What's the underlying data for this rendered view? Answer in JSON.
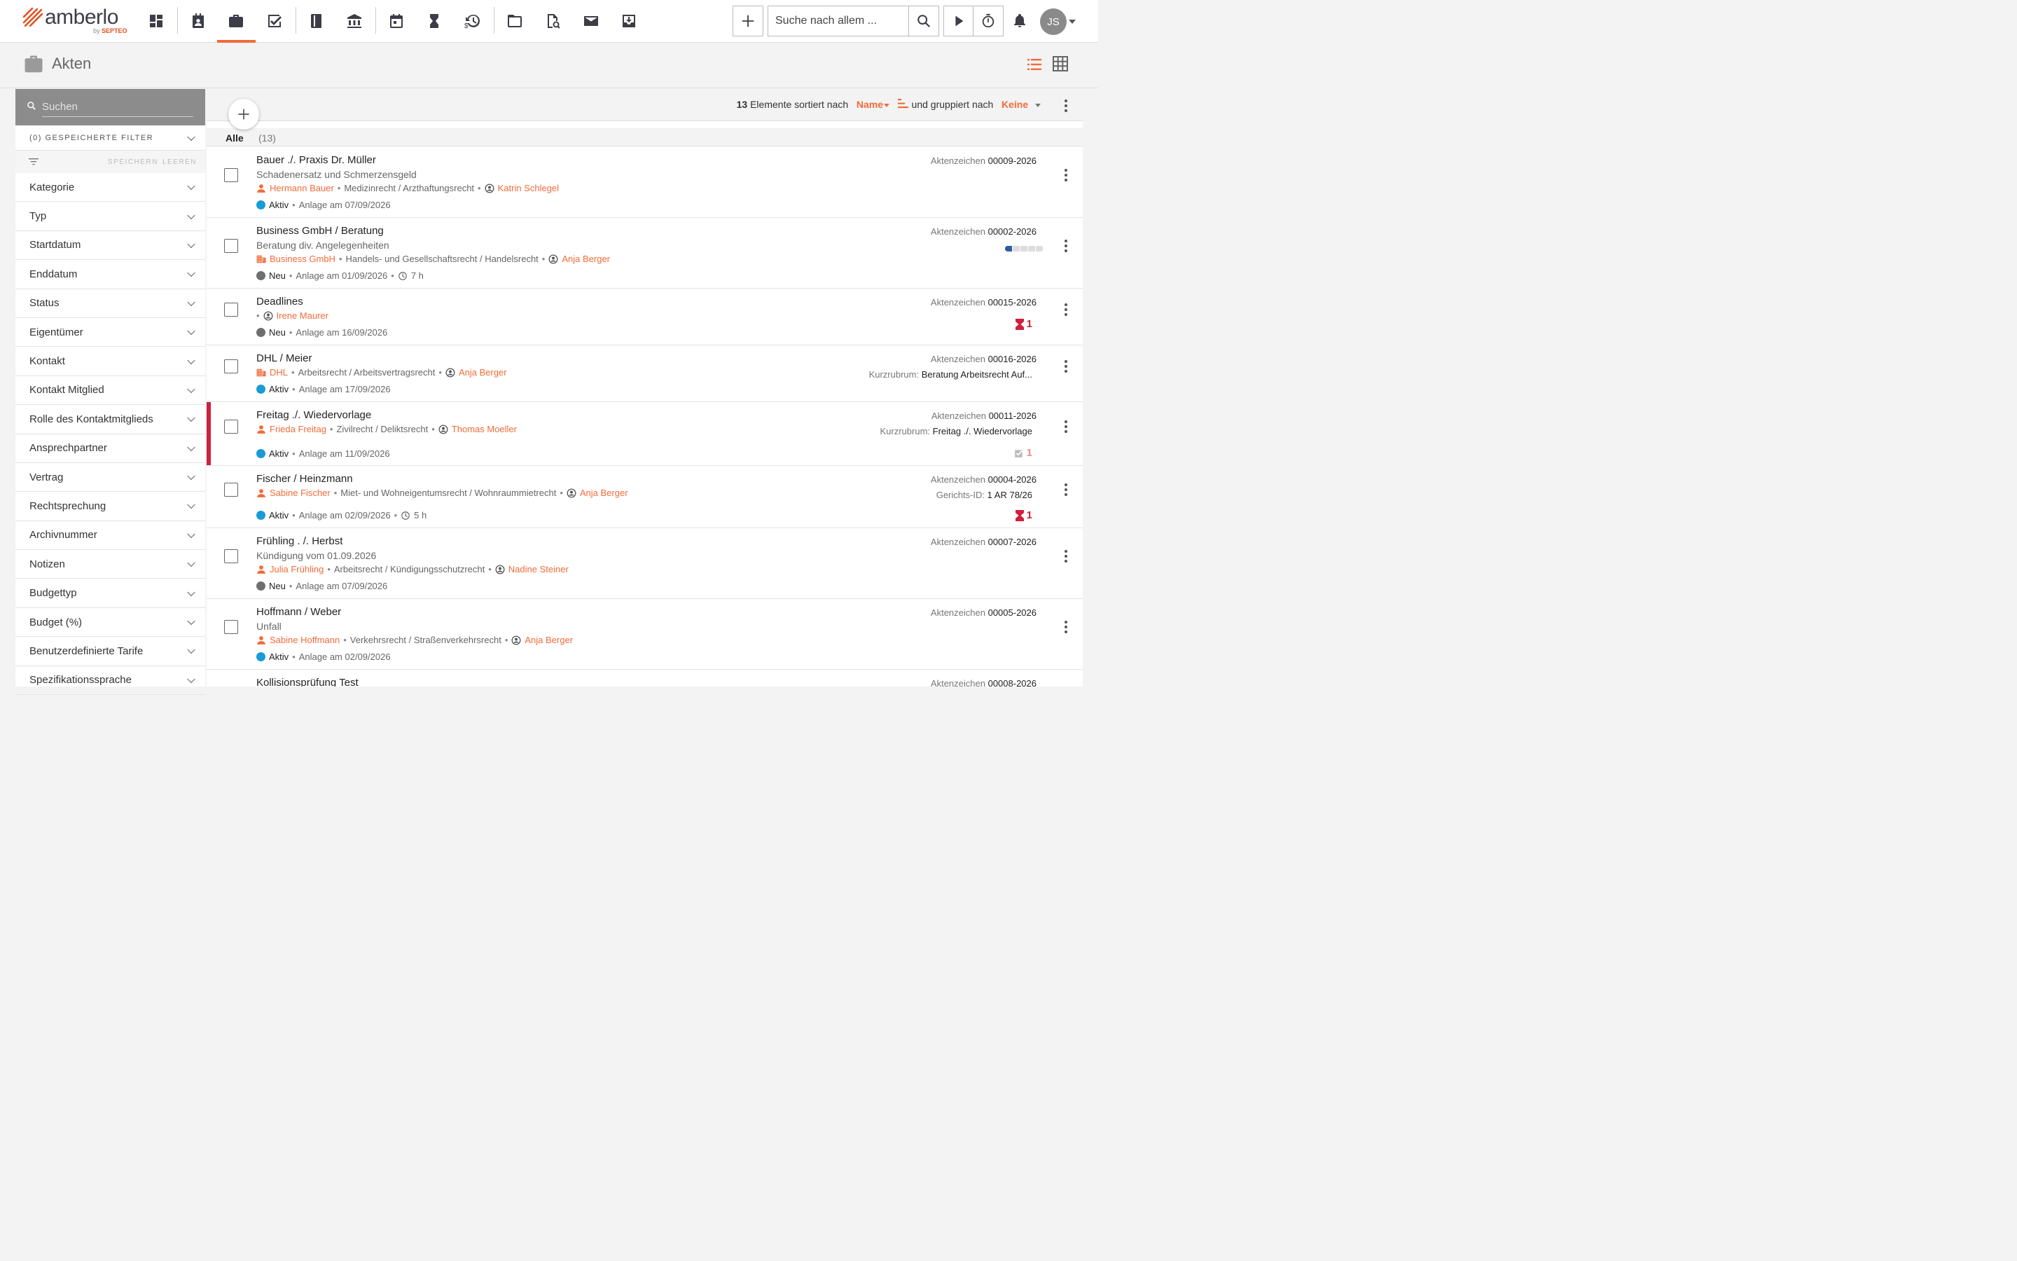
{
  "app": {
    "logo_text": "amberlo",
    "logo_by": "by",
    "logo_brand": "SEPTEO",
    "avatar_initials": "JS"
  },
  "topbar": {
    "search_placeholder": "Suche nach allem ..."
  },
  "page": {
    "title": "Akten"
  },
  "sidebar": {
    "search_placeholder": "Suchen",
    "saved_filters": "(0) GESPEICHERTE FILTER",
    "save_label": "SPEICHERN",
    "clear_label": "LEEREN",
    "filters": [
      "Kategorie",
      "Typ",
      "Startdatum",
      "Enddatum",
      "Status",
      "Eigentümer",
      "Kontakt",
      "Kontakt Mitglied",
      "Rolle des Kontaktmitglieds",
      "Ansprechpartner",
      "Vertrag",
      "Rechtsprechung",
      "Archivnummer",
      "Notizen",
      "Budgettyp",
      "Budget (%)",
      "Benutzerdefinierte Tarife",
      "Spezifikationssprache"
    ]
  },
  "list": {
    "count": "13",
    "sorted_text": "Elemente sortiert nach",
    "sort_value": "Name",
    "grouped_text": "und gruppiert nach",
    "group_value": "Keine",
    "tab_all": "Alle",
    "tab_count": "(13)",
    "rows": [
      {
        "title": "Bauer ./. Praxis Dr. Müller",
        "subtitle": "Schadenersatz und Schmerzensgeld",
        "contact": "Hermann Bauer",
        "area": "Medizinrecht / Arzthaftungsrecht",
        "owner": "Katrin Schlegel",
        "status": "Aktiv",
        "created": "Anlage am 07/09/2026",
        "ref_label": "Aktenzeichen",
        "ref": "00009-2026"
      },
      {
        "title": "Business GmbH / Beratung",
        "subtitle": "Beratung div. Angelegenheiten",
        "contact": "Business GmbH",
        "area": "Handels- und Gesellschaftsrecht / Handelsrecht",
        "owner": "Anja Berger",
        "status": "Neu",
        "created": "Anlage am 01/09/2026",
        "time": "7 h",
        "ref_label": "Aktenzeichen",
        "ref": "00002-2026",
        "budget": 0.2
      },
      {
        "title": "Deadlines",
        "owner": "Irene Maurer",
        "status": "Neu",
        "created": "Anlage am 16/09/2026",
        "ref_label": "Aktenzeichen",
        "ref": "00015-2026",
        "deadlines": "1"
      },
      {
        "title": "DHL / Meier",
        "contact": "DHL",
        "area": "Arbeitsrecht / Arbeitsvertragsrecht",
        "owner": "Anja Berger",
        "status": "Aktiv",
        "created": "Anlage am 17/09/2026",
        "ref_label": "Aktenzeichen",
        "ref": "00016-2026",
        "extra_label": "Kurzrubrum:",
        "extra": "Beratung Arbeitsrecht Auf..."
      },
      {
        "title": "Freitag ./. Wiedervorlage",
        "contact": "Frieda Freitag",
        "area": "Zivilrecht / Deliktsrecht",
        "owner": "Thomas Moeller",
        "status": "Aktiv",
        "created": "Anlage am 11/09/2026",
        "ref_label": "Aktenzeichen",
        "ref": "00011-2026",
        "extra_label": "Kurzrubrum:",
        "extra": "Freitag ./. Wiedervorlage",
        "tasks": "1"
      },
      {
        "title": "Fischer / Heinzmann",
        "contact": "Sabine Fischer",
        "area": "Miet- und Wohneigentumsrecht / Wohnraummietrecht",
        "owner": "Anja Berger",
        "status": "Aktiv",
        "created": "Anlage am 02/09/2026",
        "time": "5 h",
        "ref_label": "Aktenzeichen",
        "ref": "00004-2026",
        "extra_label": "Gerichts-ID:",
        "extra": "1 AR 78/26",
        "deadlines": "1"
      },
      {
        "title": "Frühling . /. Herbst",
        "subtitle": "Kündigung vom 01.09.2026",
        "contact": "Julia Frühling",
        "area": "Arbeitsrecht / Kündigungsschutzrecht",
        "owner": "Nadine Steiner",
        "status": "Neu",
        "created": "Anlage am 07/09/2026",
        "ref_label": "Aktenzeichen",
        "ref": "00007-2026"
      },
      {
        "title": "Hoffmann / Weber",
        "subtitle": "Unfall",
        "contact": "Sabine Hoffmann",
        "area": "Verkehrsrecht / Straßenverkehrsrecht",
        "owner": "Anja Berger",
        "status": "Aktiv",
        "created": "Anlage am 02/09/2026",
        "ref_label": "Aktenzeichen",
        "ref": "00005-2026"
      },
      {
        "title": "Kollisionsprüfung Test",
        "ref_label": "Aktenzeichen",
        "ref": "00008-2026"
      }
    ]
  },
  "colors": {
    "accent": "#f26b3a",
    "active": "#1a9bd7",
    "neu": "#6f6f6f",
    "deadline": "#d01f3c",
    "flag": "#d01f3c"
  }
}
